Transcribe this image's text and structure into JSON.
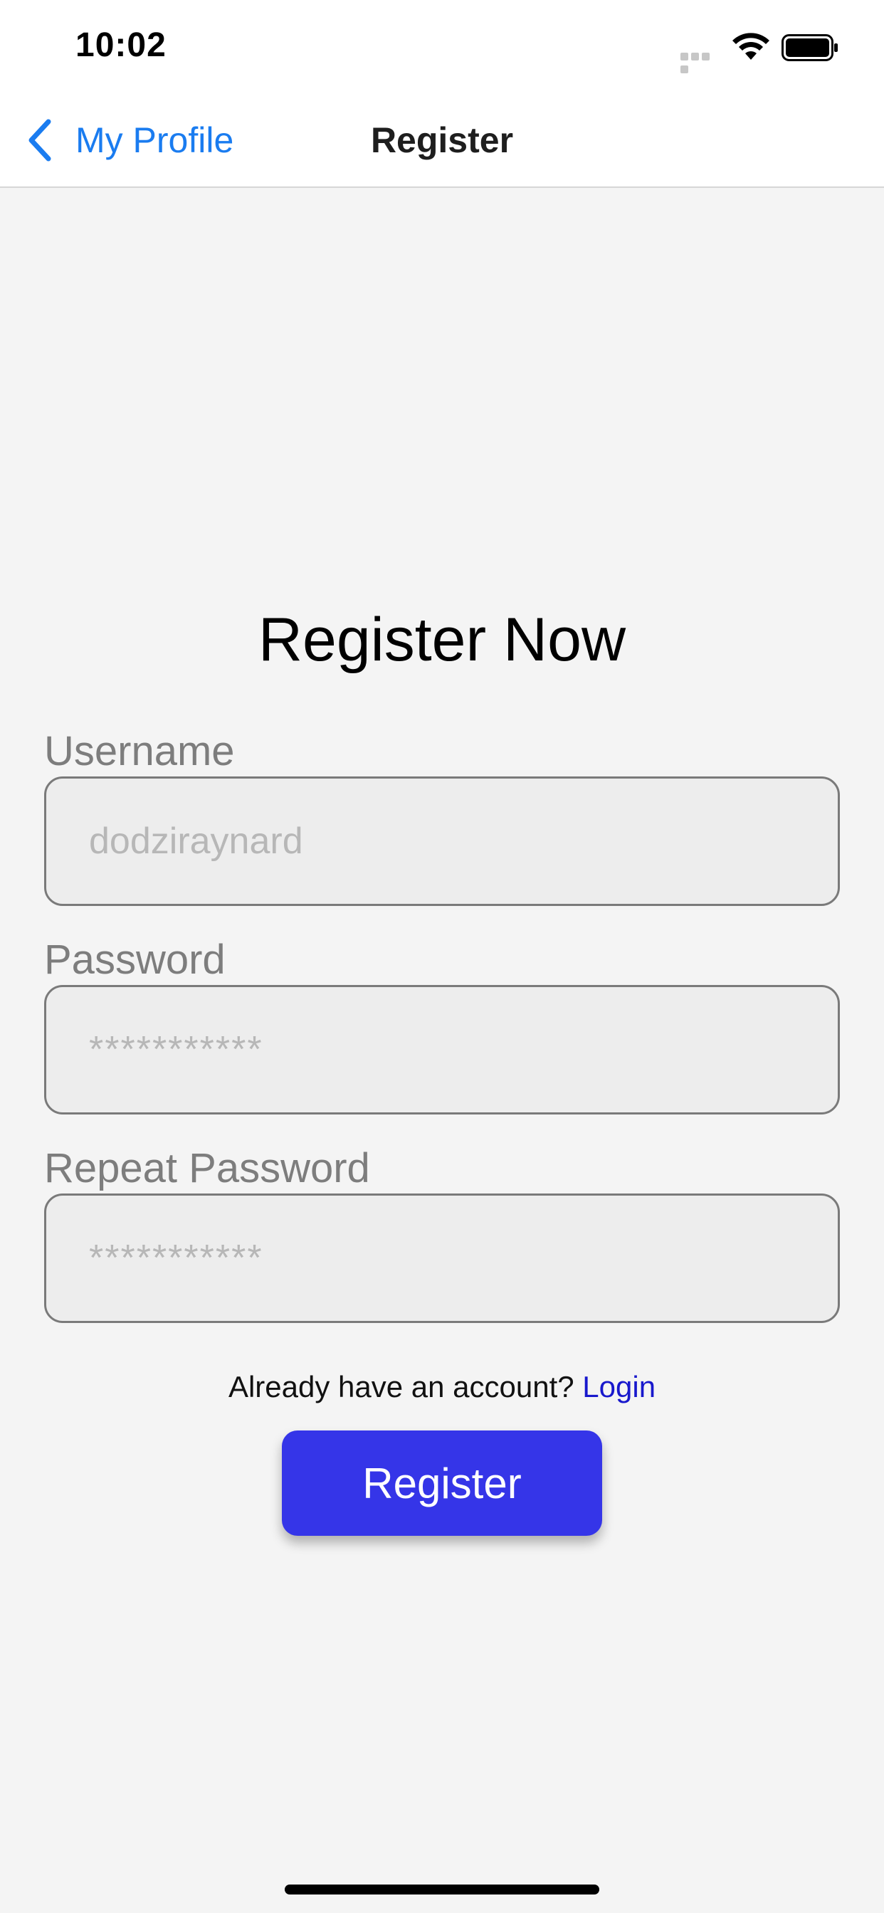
{
  "status_bar": {
    "time": "10:02"
  },
  "nav": {
    "back_label": "My Profile",
    "title": "Register"
  },
  "form": {
    "heading": "Register Now",
    "username": {
      "label": "Username",
      "placeholder": "dodziraynard"
    },
    "password": {
      "label": "Password",
      "placeholder": "***********"
    },
    "repeat_password": {
      "label": "Repeat Password",
      "placeholder": "***********"
    },
    "login_prompt": "Already have an account?",
    "login_link": "Login",
    "submit_label": "Register"
  },
  "colors": {
    "accent_blue": "#1a7cf0",
    "button_blue": "#3535e8",
    "link_blue": "#1818cc",
    "background": "#f4f4f4"
  },
  "icons": {
    "back": "chevron-left-icon",
    "signal": "cellular-signal-icon",
    "wifi": "wifi-icon",
    "battery": "battery-icon"
  }
}
